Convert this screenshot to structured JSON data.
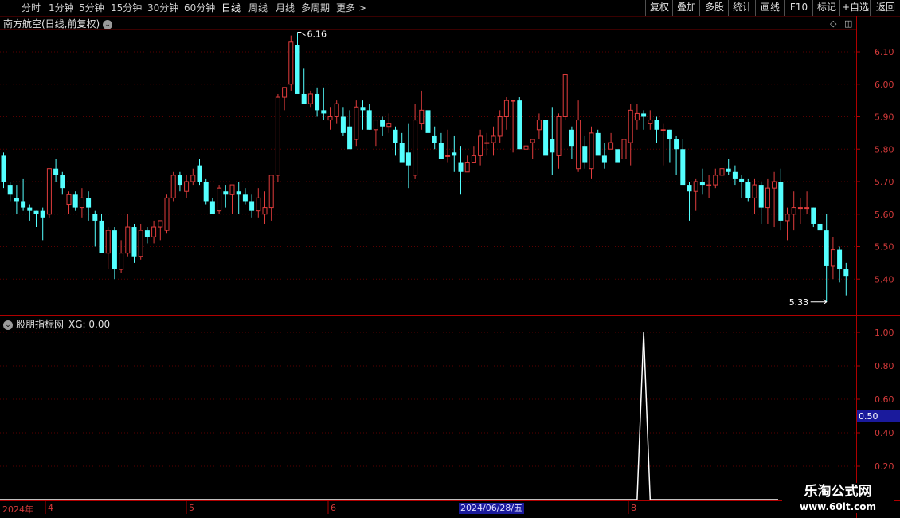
{
  "toolbar": {
    "periods": [
      "分时",
      "1分钟",
      "5分钟",
      "15分钟",
      "30分钟",
      "60分钟",
      "日线",
      "周线",
      "月线",
      "多周期",
      "更多 >"
    ],
    "active": "日线",
    "buttons": [
      "复权",
      "叠加",
      "多股",
      "统计",
      "画线",
      "F10",
      "标记",
      "+自选",
      "返回"
    ]
  },
  "main_panel": {
    "title": "南方航空(日线,前复权)",
    "high_label": "6.16",
    "low_label": "5.33",
    "y_ticks": [
      "6.10",
      "6.00",
      "5.90",
      "5.80",
      "5.70",
      "5.60",
      "5.50",
      "5.40"
    ]
  },
  "indicator_panel": {
    "title": "股朋指标网",
    "value_label": "XG: 0.00",
    "y_ticks": [
      "1.00",
      "0.80",
      "0.60",
      "0.40",
      "0.20"
    ],
    "cursor_value": "0.50"
  },
  "timeline": {
    "year": "2024年",
    "months": [
      "4",
      "5",
      "6",
      "8"
    ],
    "cursor_date": "2024/06/28/五"
  },
  "watermark": {
    "line1": "乐淘公式网",
    "line2": "www.60lt.com"
  },
  "colors": {
    "up": "#e03c3c",
    "down": "#54ffff",
    "indicator_line": "#ffffff",
    "axis": "#8b0000"
  },
  "chart_data": [
    {
      "type": "candlestick",
      "title": "南方航空(日线,前复权)",
      "y_range": [
        5.31,
        6.19
      ],
      "annotations": [
        {
          "text": "6.16",
          "kind": "high"
        },
        {
          "text": "5.33",
          "kind": "low"
        }
      ],
      "candles": [
        [
          5.78,
          5.79,
          5.68,
          5.7
        ],
        [
          5.69,
          5.7,
          5.64,
          5.66
        ],
        [
          5.65,
          5.69,
          5.6,
          5.64
        ],
        [
          5.64,
          5.71,
          5.61,
          5.62
        ],
        [
          5.62,
          5.63,
          5.58,
          5.61
        ],
        [
          5.61,
          5.61,
          5.56,
          5.6
        ],
        [
          5.61,
          5.62,
          5.52,
          5.59
        ],
        [
          5.6,
          5.72,
          5.59,
          5.74
        ],
        [
          5.74,
          5.77,
          5.7,
          5.72
        ],
        [
          5.72,
          5.73,
          5.66,
          5.68
        ],
        [
          5.63,
          5.67,
          5.6,
          5.66
        ],
        [
          5.66,
          5.67,
          5.61,
          5.62
        ],
        [
          5.62,
          5.68,
          5.59,
          5.65
        ],
        [
          5.65,
          5.67,
          5.58,
          5.62
        ],
        [
          5.6,
          5.61,
          5.5,
          5.58
        ],
        [
          5.58,
          5.6,
          5.49,
          5.48
        ],
        [
          5.48,
          5.56,
          5.43,
          5.55
        ],
        [
          5.55,
          5.56,
          5.4,
          5.43
        ],
        [
          5.43,
          5.52,
          5.42,
          5.48
        ],
        [
          5.48,
          5.6,
          5.47,
          5.56
        ],
        [
          5.56,
          5.57,
          5.45,
          5.47
        ],
        [
          5.47,
          5.57,
          5.46,
          5.55
        ],
        [
          5.55,
          5.56,
          5.51,
          5.53
        ],
        [
          5.53,
          5.58,
          5.51,
          5.56
        ],
        [
          5.56,
          5.58,
          5.52,
          5.58
        ],
        [
          5.55,
          5.66,
          5.54,
          5.65
        ],
        [
          5.65,
          5.73,
          5.64,
          5.72
        ],
        [
          5.72,
          5.73,
          5.67,
          5.69
        ],
        [
          5.67,
          5.72,
          5.65,
          5.7
        ],
        [
          5.7,
          5.74,
          5.69,
          5.72
        ],
        [
          5.75,
          5.77,
          5.69,
          5.7
        ],
        [
          5.7,
          5.71,
          5.63,
          5.64
        ],
        [
          5.64,
          5.65,
          5.61,
          5.6
        ],
        [
          5.61,
          5.69,
          5.6,
          5.68
        ],
        [
          5.67,
          5.69,
          5.62,
          5.66
        ],
        [
          5.66,
          5.69,
          5.6,
          5.69
        ],
        [
          5.67,
          5.7,
          5.6,
          5.66
        ],
        [
          5.66,
          5.68,
          5.63,
          5.64
        ],
        [
          5.64,
          5.66,
          5.59,
          5.61
        ],
        [
          5.61,
          5.68,
          5.59,
          5.65
        ],
        [
          5.6,
          5.67,
          5.57,
          5.62
        ],
        [
          5.62,
          5.71,
          5.58,
          5.72
        ],
        [
          5.72,
          5.97,
          5.7,
          5.96
        ],
        [
          5.96,
          5.99,
          5.92,
          5.99
        ],
        [
          6.0,
          6.15,
          5.98,
          6.13
        ],
        [
          6.12,
          6.16,
          5.99,
          5.97
        ],
        [
          5.97,
          6.05,
          5.96,
          5.94
        ],
        [
          5.94,
          5.98,
          5.93,
          5.97
        ],
        [
          5.97,
          5.99,
          5.9,
          5.92
        ],
        [
          5.92,
          5.99,
          5.89,
          5.91
        ],
        [
          5.89,
          5.93,
          5.86,
          5.9
        ],
        [
          5.9,
          5.95,
          5.88,
          5.94
        ],
        [
          5.9,
          5.93,
          5.84,
          5.85
        ],
        [
          5.87,
          5.92,
          5.81,
          5.8
        ],
        [
          5.83,
          5.95,
          5.81,
          5.93
        ],
        [
          5.93,
          5.95,
          5.86,
          5.92
        ],
        [
          5.92,
          5.94,
          5.86,
          5.86
        ],
        [
          5.86,
          5.89,
          5.81,
          5.89
        ],
        [
          5.89,
          5.9,
          5.84,
          5.87
        ],
        [
          5.87,
          5.91,
          5.85,
          5.88
        ],
        [
          5.86,
          5.87,
          5.78,
          5.82
        ],
        [
          5.82,
          5.85,
          5.78,
          5.76
        ],
        [
          5.79,
          5.88,
          5.68,
          5.75
        ],
        [
          5.72,
          5.94,
          5.71,
          5.89
        ],
        [
          5.88,
          5.98,
          5.86,
          5.92
        ],
        [
          5.92,
          5.96,
          5.83,
          5.85
        ],
        [
          5.84,
          5.87,
          5.8,
          5.82
        ],
        [
          5.82,
          5.85,
          5.8,
          5.77
        ],
        [
          5.78,
          5.86,
          5.76,
          5.78
        ],
        [
          5.79,
          5.84,
          5.73,
          5.78
        ],
        [
          5.76,
          5.81,
          5.66,
          5.73
        ],
        [
          5.73,
          5.78,
          5.74,
          5.76
        ],
        [
          5.76,
          5.81,
          5.76,
          5.78
        ],
        [
          5.78,
          5.86,
          5.75,
          5.84
        ],
        [
          5.82,
          5.85,
          5.78,
          5.82
        ],
        [
          5.82,
          5.87,
          5.78,
          5.84
        ],
        [
          5.84,
          5.92,
          5.82,
          5.9
        ],
        [
          5.9,
          5.96,
          5.86,
          5.95
        ],
        [
          5.95,
          5.95,
          5.79,
          5.95
        ],
        [
          5.95,
          5.96,
          5.86,
          5.8
        ],
        [
          5.8,
          5.83,
          5.78,
          5.81
        ],
        [
          5.82,
          5.82,
          5.77,
          5.83
        ],
        [
          5.86,
          5.91,
          5.83,
          5.89
        ],
        [
          5.89,
          5.89,
          5.8,
          5.78
        ],
        [
          5.83,
          5.93,
          5.72,
          5.79
        ],
        [
          5.78,
          5.91,
          5.74,
          5.9
        ],
        [
          5.9,
          6.03,
          5.89,
          6.03
        ],
        [
          5.86,
          5.87,
          5.77,
          5.81
        ],
        [
          5.74,
          5.95,
          5.73,
          5.89
        ],
        [
          5.81,
          5.84,
          5.74,
          5.76
        ],
        [
          5.74,
          5.87,
          5.71,
          5.85
        ],
        [
          5.85,
          5.86,
          5.84,
          5.78
        ],
        [
          5.78,
          5.82,
          5.74,
          5.76
        ],
        [
          5.8,
          5.85,
          5.8,
          5.82
        ],
        [
          5.8,
          5.79,
          5.77,
          5.76
        ],
        [
          5.77,
          5.84,
          5.73,
          5.83
        ],
        [
          5.82,
          5.94,
          5.75,
          5.92
        ],
        [
          5.89,
          5.94,
          5.86,
          5.91
        ],
        [
          5.91,
          5.92,
          5.86,
          5.9
        ],
        [
          5.88,
          5.92,
          5.86,
          5.89
        ],
        [
          5.89,
          5.9,
          5.82,
          5.86
        ],
        [
          5.86,
          5.88,
          5.75,
          5.86
        ],
        [
          5.86,
          5.86,
          5.76,
          5.83
        ],
        [
          5.83,
          5.84,
          5.72,
          5.8
        ],
        [
          5.8,
          5.83,
          5.77,
          5.69
        ],
        [
          5.69,
          5.7,
          5.58,
          5.67
        ],
        [
          5.67,
          5.71,
          5.61,
          5.7
        ],
        [
          5.7,
          5.74,
          5.66,
          5.69
        ],
        [
          5.69,
          5.72,
          5.65,
          5.69
        ],
        [
          5.69,
          5.74,
          5.68,
          5.72
        ],
        [
          5.72,
          5.77,
          5.68,
          5.74
        ],
        [
          5.74,
          5.77,
          5.72,
          5.73
        ],
        [
          5.73,
          5.75,
          5.69,
          5.71
        ],
        [
          5.71,
          5.72,
          5.65,
          5.7
        ],
        [
          5.7,
          5.71,
          5.64,
          5.65
        ],
        [
          5.65,
          5.71,
          5.6,
          5.69
        ],
        [
          5.69,
          5.7,
          5.57,
          5.62
        ],
        [
          5.62,
          5.71,
          5.57,
          5.68
        ],
        [
          5.68,
          5.73,
          5.56,
          5.7
        ],
        [
          5.7,
          5.74,
          5.55,
          5.58
        ],
        [
          5.58,
          5.62,
          5.52,
          5.6
        ],
        [
          5.6,
          5.67,
          5.55,
          5.62
        ],
        [
          5.62,
          5.65,
          5.57,
          5.62
        ],
        [
          5.62,
          5.67,
          5.6,
          5.62
        ],
        [
          5.62,
          5.62,
          5.56,
          5.57
        ],
        [
          5.57,
          5.61,
          5.53,
          5.55
        ],
        [
          5.55,
          5.6,
          5.33,
          5.44
        ],
        [
          5.44,
          5.53,
          5.4,
          5.49
        ],
        [
          5.49,
          5.5,
          5.39,
          5.43
        ],
        [
          5.43,
          5.45,
          5.35,
          5.41
        ]
      ]
    },
    {
      "type": "line",
      "title": "股朋指标网",
      "series": [
        {
          "name": "XG",
          "spike_index": 98,
          "values_note": "0 everywhere except 1 at spike"
        }
      ],
      "y_range": [
        0,
        1
      ]
    }
  ]
}
